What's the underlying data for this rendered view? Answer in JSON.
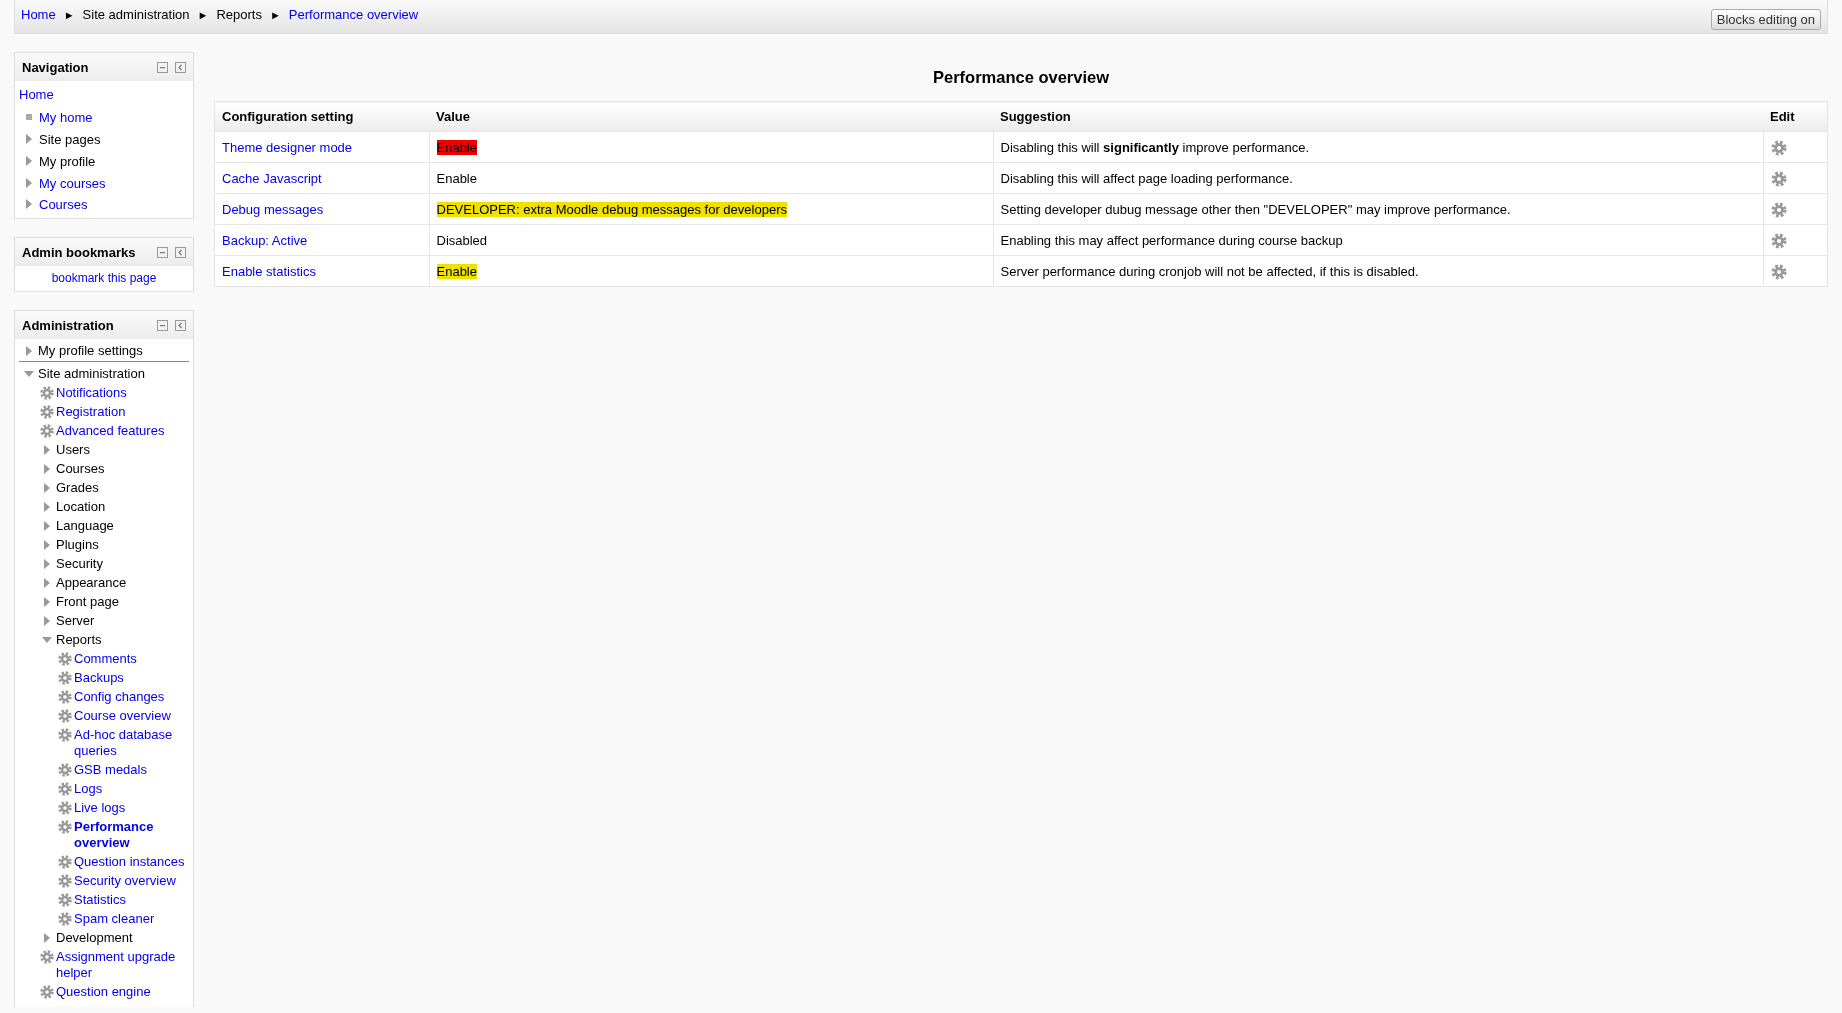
{
  "breadcrumb": [
    {
      "label": "Home",
      "link": true
    },
    {
      "label": "Site administration",
      "link": false
    },
    {
      "label": "Reports",
      "link": false
    },
    {
      "label": "Performance overview",
      "link": true
    }
  ],
  "breadcrumb_separator": "►",
  "edit_button": "Blocks editing on",
  "navigation": {
    "title": "Navigation",
    "home": "Home",
    "items": [
      {
        "label": "My home",
        "kind": "bullet",
        "link": true
      },
      {
        "label": "Site pages",
        "kind": "caret",
        "link": false
      },
      {
        "label": "My profile",
        "kind": "caret",
        "link": false
      },
      {
        "label": "My courses",
        "kind": "caret",
        "link": true
      },
      {
        "label": "Courses",
        "kind": "caret",
        "link": true
      }
    ]
  },
  "admin_bookmarks": {
    "title": "Admin bookmarks",
    "link": "bookmark this page"
  },
  "administration": {
    "title": "Administration",
    "items": [
      {
        "label": "My profile settings",
        "kind": "category",
        "expanded": false,
        "selected": false,
        "divider": true
      },
      {
        "label": "Site administration",
        "kind": "category",
        "expanded": true,
        "selected": false,
        "children": [
          {
            "label": "Notifications",
            "kind": "setting",
            "selected": false
          },
          {
            "label": "Registration",
            "kind": "setting",
            "selected": false
          },
          {
            "label": "Advanced features",
            "kind": "setting",
            "selected": false
          },
          {
            "label": "Users",
            "kind": "category",
            "expanded": false,
            "selected": false
          },
          {
            "label": "Courses",
            "kind": "category",
            "expanded": false,
            "selected": false
          },
          {
            "label": "Grades",
            "kind": "category",
            "expanded": false,
            "selected": false
          },
          {
            "label": "Location",
            "kind": "category",
            "expanded": false,
            "selected": false
          },
          {
            "label": "Language",
            "kind": "category",
            "expanded": false,
            "selected": false
          },
          {
            "label": "Plugins",
            "kind": "category",
            "expanded": false,
            "selected": false
          },
          {
            "label": "Security",
            "kind": "category",
            "expanded": false,
            "selected": false
          },
          {
            "label": "Appearance",
            "kind": "category",
            "expanded": false,
            "selected": false
          },
          {
            "label": "Front page",
            "kind": "category",
            "expanded": false,
            "selected": false
          },
          {
            "label": "Server",
            "kind": "category",
            "expanded": false,
            "selected": false
          },
          {
            "label": "Reports",
            "kind": "category",
            "expanded": true,
            "selected": false,
            "children": [
              {
                "label": "Comments",
                "kind": "setting",
                "selected": false
              },
              {
                "label": "Backups",
                "kind": "setting",
                "selected": false
              },
              {
                "label": "Config changes",
                "kind": "setting",
                "selected": false
              },
              {
                "label": "Course overview",
                "kind": "setting",
                "selected": false
              },
              {
                "label": "Ad-hoc database queries",
                "kind": "setting",
                "selected": false
              },
              {
                "label": "GSB medals",
                "kind": "setting",
                "selected": false
              },
              {
                "label": "Logs",
                "kind": "setting",
                "selected": false
              },
              {
                "label": "Live logs",
                "kind": "setting",
                "selected": false
              },
              {
                "label": "Performance overview",
                "kind": "setting",
                "selected": true
              },
              {
                "label": "Question instances",
                "kind": "setting",
                "selected": false
              },
              {
                "label": "Security overview",
                "kind": "setting",
                "selected": false
              },
              {
                "label": "Statistics",
                "kind": "setting",
                "selected": false
              },
              {
                "label": "Spam cleaner",
                "kind": "setting",
                "selected": false
              }
            ]
          },
          {
            "label": "Development",
            "kind": "category",
            "expanded": false,
            "selected": false
          },
          {
            "label": "Assignment upgrade helper",
            "kind": "setting",
            "selected": false
          },
          {
            "label": "Question engine",
            "kind": "setting",
            "selected": false
          }
        ]
      }
    ]
  },
  "page_title": "Performance overview",
  "table": {
    "columns": [
      "Configuration setting",
      "Value",
      "Suggestion",
      "Edit"
    ],
    "rows": [
      {
        "setting": "Theme designer mode",
        "value": "Enable",
        "color": "#ee0000",
        "suggestion": "Disabling this will **significantly** improve performance."
      },
      {
        "setting": "Cache Javascript",
        "value": "Enable",
        "suggestion": "Disabling this will affect page loading performance."
      },
      {
        "setting": "Debug messages",
        "value": "DEVELOPER: extra Moodle debug messages for developers",
        "color": "#f0e000",
        "suggestion": "Setting developer dubug message other then \"DEVELOPER\" may improve performance."
      },
      {
        "setting": "Backup: Active",
        "value": "Disabled",
        "suggestion": "Enabling this may affect performance during course backup"
      },
      {
        "setting": "Enable statistics",
        "value": "Enable",
        "color": "#f0e000",
        "suggestion": "Server performance during cronjob will not be affected, if this is disabled."
      }
    ]
  }
}
